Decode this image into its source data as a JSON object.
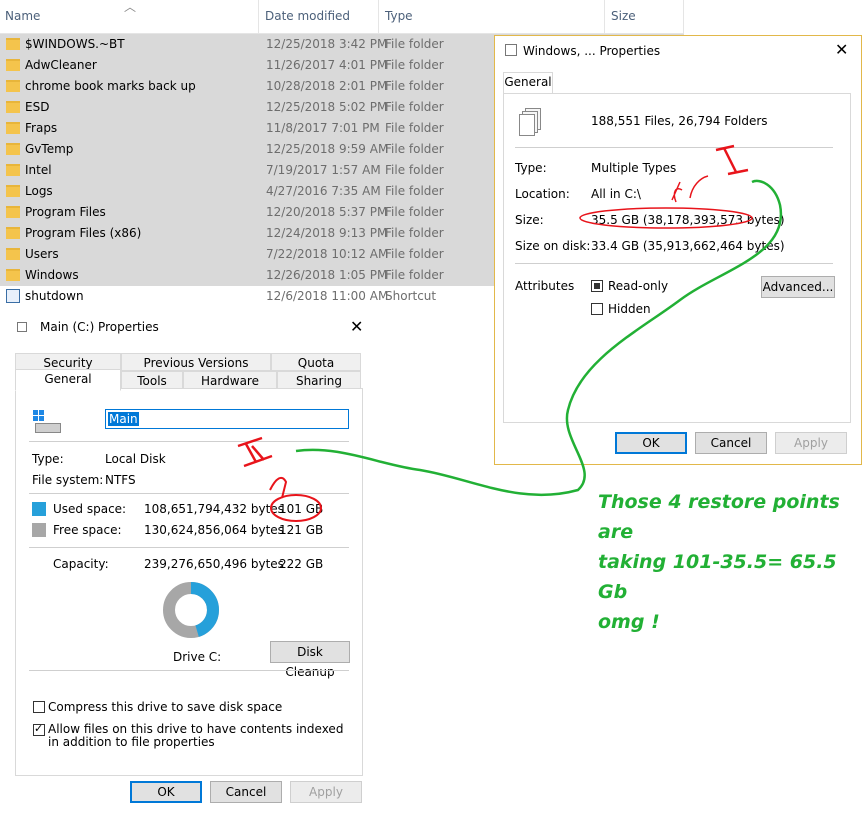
{
  "explorer": {
    "columns": {
      "name": "Name",
      "date": "Date modified",
      "type": "Type",
      "size": "Size"
    },
    "rows": [
      {
        "name": "$WINDOWS.~BT",
        "date": "12/25/2018 3:42 PM",
        "type": "File folder",
        "icon": "folder-icon"
      },
      {
        "name": "AdwCleaner",
        "date": "11/26/2017 4:01 PM",
        "type": "File folder",
        "icon": "folder-icon"
      },
      {
        "name": "chrome book marks back up",
        "date": "10/28/2018 2:01 PM",
        "type": "File folder",
        "icon": "folder-icon"
      },
      {
        "name": "ESD",
        "date": "12/25/2018 5:02 PM",
        "type": "File folder",
        "icon": "folder-icon"
      },
      {
        "name": "Fraps",
        "date": "11/8/2017 7:01 PM",
        "type": "File folder",
        "icon": "folder-icon"
      },
      {
        "name": "GvTemp",
        "date": "12/25/2018 9:59 AM",
        "type": "File folder",
        "icon": "folder-icon"
      },
      {
        "name": "Intel",
        "date": "7/19/2017 1:57 AM",
        "type": "File folder",
        "icon": "folder-icon"
      },
      {
        "name": "Logs",
        "date": "4/27/2016 7:35 AM",
        "type": "File folder",
        "icon": "folder-icon"
      },
      {
        "name": "Program Files",
        "date": "12/20/2018 5:37 PM",
        "type": "File folder",
        "icon": "folder-icon"
      },
      {
        "name": "Program Files (x86)",
        "date": "12/24/2018 9:13 PM",
        "type": "File folder",
        "icon": "folder-icon"
      },
      {
        "name": "Users",
        "date": "7/22/2018 10:12 AM",
        "type": "File folder",
        "icon": "folder-icon"
      },
      {
        "name": "Windows",
        "date": "12/26/2018 1:05 PM",
        "type": "File folder",
        "icon": "folder-icon"
      },
      {
        "name": "shutdown",
        "date": "12/6/2018 11:00 AM",
        "type": "Shortcut",
        "icon": "shortcut-icon"
      }
    ]
  },
  "windows_props": {
    "title": "Windows, ... Properties",
    "close": "✕",
    "tab": "General",
    "summary": "188,551 Files, 26,794 Folders",
    "type_label": "Type:",
    "type_value": "Multiple Types",
    "location_label": "Location:",
    "location_value": "All in C:\\",
    "size_label": "Size:",
    "size_value": "35.5 GB (38,178,393,573 bytes)",
    "size_on_disk_label": "Size on disk:",
    "size_on_disk_value": "33.4 GB (35,913,662,464 bytes)",
    "attributes_label": "Attributes",
    "readonly_label": "Read-only",
    "hidden_label": "Hidden",
    "advanced_button": "Advanced...",
    "ok": "OK",
    "cancel": "Cancel",
    "apply": "Apply"
  },
  "drive_props": {
    "title": "Main  (C:) Properties",
    "close": "✕",
    "tabs_top": [
      "Security",
      "Previous Versions",
      "Quota"
    ],
    "tabs_bottom": [
      "General",
      "Tools",
      "Hardware",
      "Sharing"
    ],
    "name_value": "Main",
    "type_label": "Type:",
    "type_value": "Local Disk",
    "fs_label": "File system:",
    "fs_value": "NTFS",
    "used_label": "Used space:",
    "used_bytes": "108,651,794,432 bytes",
    "used_gb": "101 GB",
    "free_label": "Free space:",
    "free_bytes": "130,624,856,064 bytes",
    "free_gb": "121 GB",
    "capacity_label": "Capacity:",
    "capacity_bytes": "239,276,650,496 bytes",
    "capacity_gb": "222 GB",
    "used_fraction": 0.454,
    "drive_label": "Drive C:",
    "cleanup_button": "Disk Cleanup",
    "compress_label": "Compress this drive to save disk space",
    "index_label": "Allow files on this drive to have contents indexed in addition to file properties",
    "ok": "OK",
    "cancel": "Cancel",
    "apply": "Apply",
    "colors": {
      "used": "#26a0da",
      "free": "#a7a7a7"
    }
  },
  "annotation": {
    "line1": "Those 4 restore points are",
    "line2": "taking 101-35.5= 65.5 Gb",
    "line3": "omg !",
    "color": "#22b035",
    "marker_color": "#e8141b"
  }
}
